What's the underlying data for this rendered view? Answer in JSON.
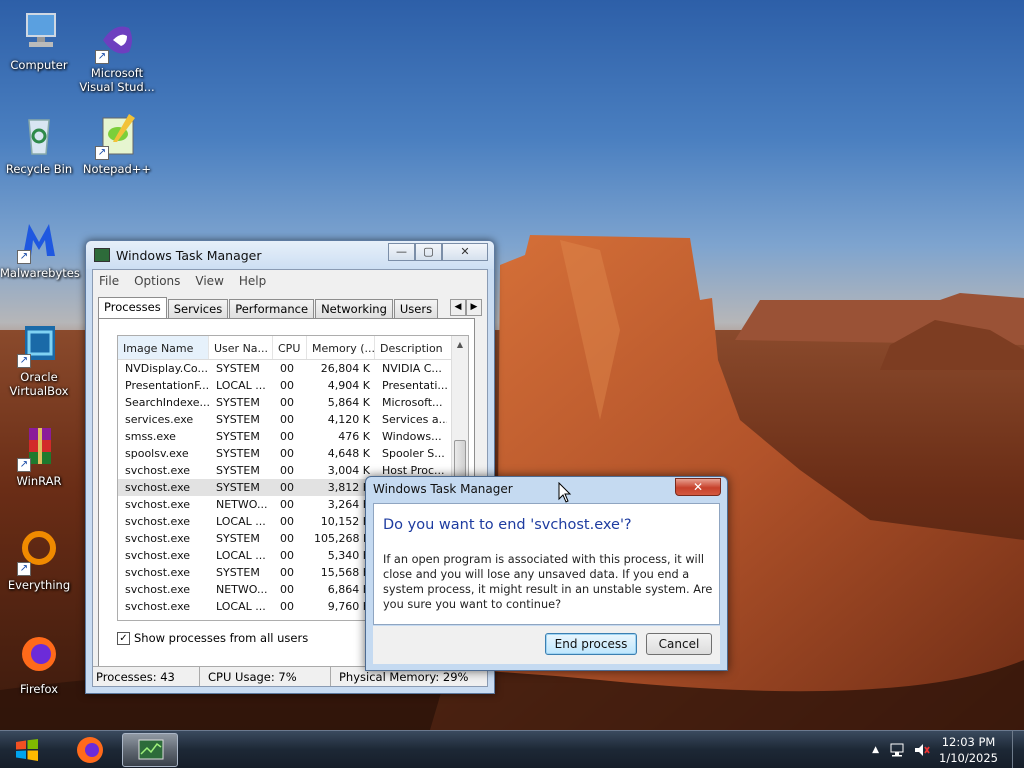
{
  "desktop_icons": [
    {
      "label": "Computer",
      "icon": "computer-icon"
    },
    {
      "label": "Microsoft Visual Stud...",
      "icon": "visual-studio-icon"
    },
    {
      "label": "Recycle Bin",
      "icon": "recycle-bin-icon"
    },
    {
      "label": "Notepad++",
      "icon": "notepad-plus-plus-icon"
    },
    {
      "label": "Malwarebytes",
      "icon": "malwarebytes-icon"
    },
    {
      "label": "Oracle VirtualBox",
      "icon": "virtualbox-icon"
    },
    {
      "label": "WinRAR",
      "icon": "winrar-icon"
    },
    {
      "label": "Everything",
      "icon": "everything-icon"
    },
    {
      "label": "Firefox",
      "icon": "firefox-icon"
    }
  ],
  "task_manager": {
    "title": "Windows Task Manager",
    "caption_buttons": {
      "minimize": "—",
      "maximize": "▢",
      "close": "✕"
    },
    "menu": [
      "File",
      "Options",
      "View",
      "Help"
    ],
    "tabs": [
      "Processes",
      "Services",
      "Performance",
      "Networking",
      "Users"
    ],
    "active_tab": "Processes",
    "columns": [
      "Image Name",
      "User Na...",
      "CPU",
      "Memory (...",
      "Description"
    ],
    "processes": [
      [
        "NVDisplay.Co...",
        "SYSTEM",
        "00",
        "26,804 K",
        "NVIDIA C..."
      ],
      [
        "PresentationF...",
        "LOCAL ...",
        "00",
        "4,904 K",
        "Presentati..."
      ],
      [
        "SearchIndexe...",
        "SYSTEM",
        "00",
        "5,864 K",
        "Microsoft..."
      ],
      [
        "services.exe",
        "SYSTEM",
        "00",
        "4,120 K",
        "Services a..."
      ],
      [
        "smss.exe",
        "SYSTEM",
        "00",
        "476 K",
        "Windows..."
      ],
      [
        "spoolsv.exe",
        "SYSTEM",
        "00",
        "4,648 K",
        "Spooler S..."
      ],
      [
        "svchost.exe",
        "SYSTEM",
        "00",
        "3,004 K",
        "Host Proc..."
      ],
      [
        "svchost.exe",
        "SYSTEM",
        "00",
        "3,812 K",
        ""
      ],
      [
        "svchost.exe",
        "NETWO...",
        "00",
        "3,264 K",
        ""
      ],
      [
        "svchost.exe",
        "LOCAL ...",
        "00",
        "10,152 K",
        ""
      ],
      [
        "svchost.exe",
        "SYSTEM",
        "00",
        "105,268 K",
        ""
      ],
      [
        "svchost.exe",
        "LOCAL ...",
        "00",
        "5,340 K",
        ""
      ],
      [
        "svchost.exe",
        "SYSTEM",
        "00",
        "15,568 K",
        ""
      ],
      [
        "svchost.exe",
        "NETWO...",
        "00",
        "6,864 K",
        ""
      ],
      [
        "svchost.exe",
        "LOCAL ...",
        "00",
        "9,760 K",
        ""
      ]
    ],
    "selected_row": 7,
    "show_all_label": "Show processes from all users",
    "show_all_checked": true,
    "status": {
      "processes": "Processes: 43",
      "cpu": "CPU Usage: 7%",
      "memory": "Physical Memory: 29%"
    }
  },
  "dialog": {
    "title": "Windows Task Manager",
    "close_glyph": "✕",
    "heading": "Do you want to end 'svchost.exe'?",
    "message": "If an open program is associated with this process, it will close and you will lose any unsaved data. If you end a system process, it might result in an unstable system. Are you sure you want to continue?",
    "end_button": "End process",
    "cancel_button": "Cancel"
  },
  "taskbar": {
    "items": [
      "start-button",
      "firefox-icon",
      "task-manager-icon"
    ],
    "time": "12:03 PM",
    "date": "1/10/2025"
  },
  "colors": {
    "dialog_heading": "#1e3ca0",
    "taskbar": "#1d2836",
    "window_frame": "#c9dcf2"
  }
}
